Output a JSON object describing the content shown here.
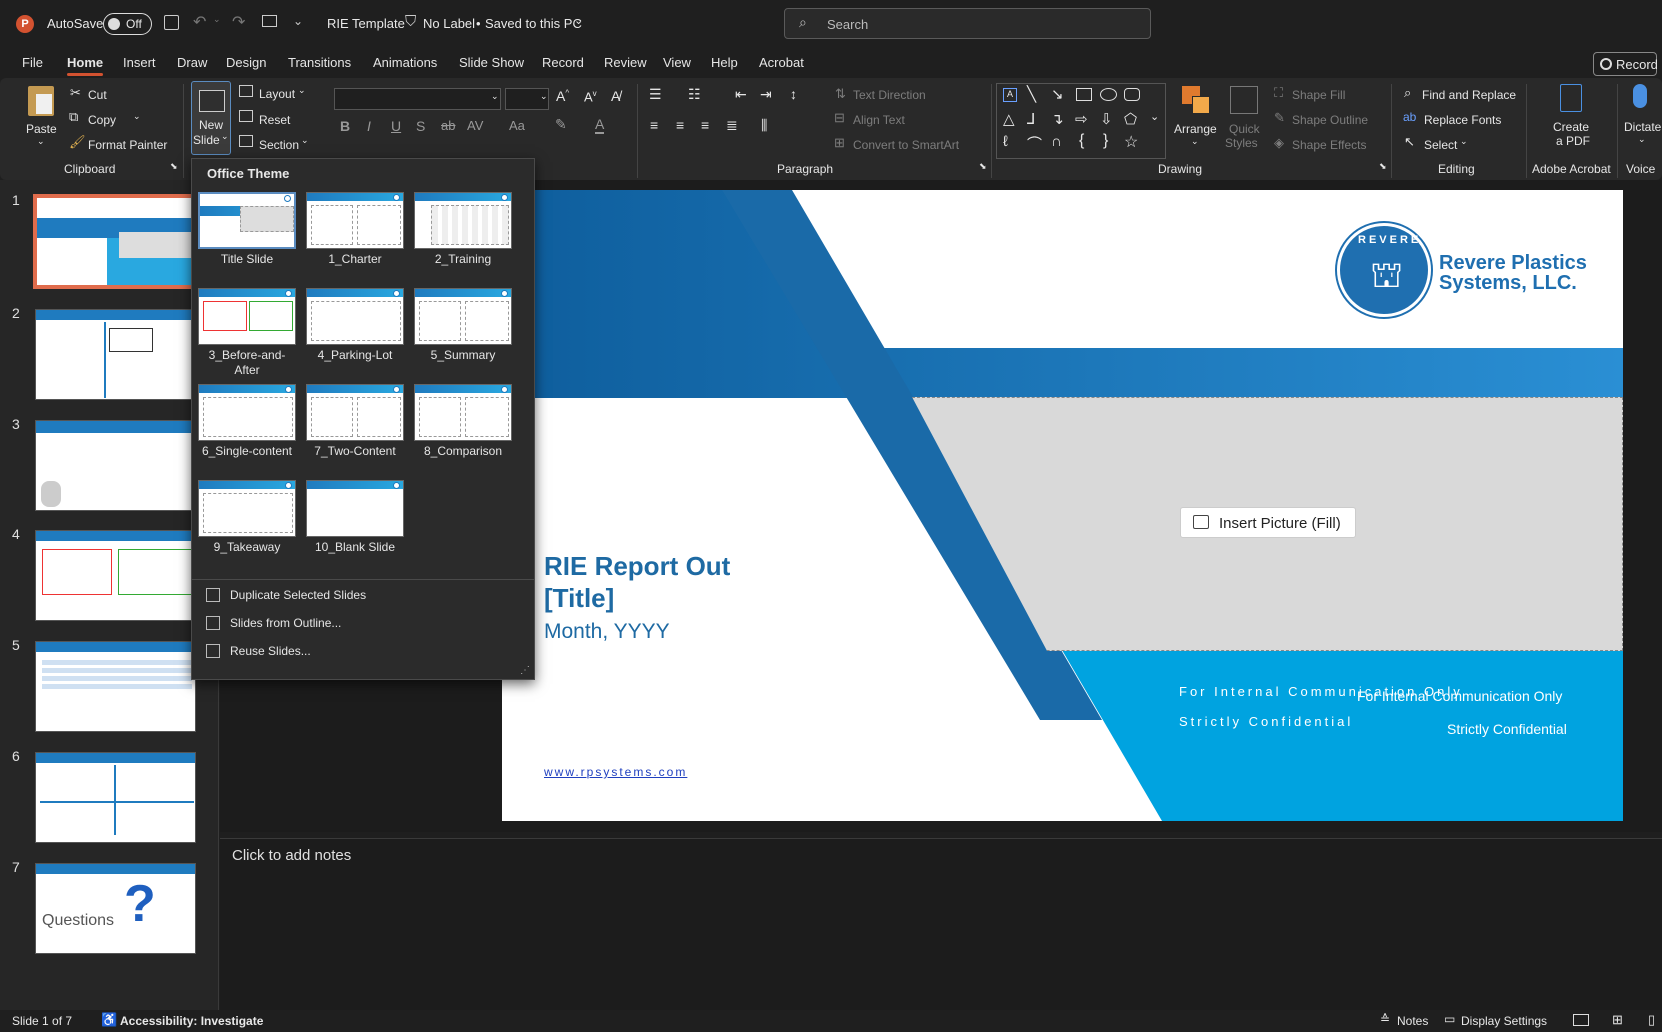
{
  "titlebar": {
    "autosave_label": "AutoSave",
    "autosave_state": "Off",
    "doc_title": "RIE Template",
    "label_status": "No Label",
    "save_status": "Saved to this PC",
    "search_placeholder": "Search"
  },
  "tabs": [
    "File",
    "Home",
    "Insert",
    "Draw",
    "Design",
    "Transitions",
    "Animations",
    "Slide Show",
    "Record",
    "Review",
    "View",
    "Help",
    "Acrobat"
  ],
  "record_button": "Record",
  "ribbon": {
    "clipboard": {
      "paste": "Paste",
      "cut": "Cut",
      "copy": "Copy",
      "format_painter": "Format Painter",
      "label": "Clipboard"
    },
    "slides": {
      "new_slide_1": "New",
      "new_slide_2": "Slide",
      "layout": "Layout",
      "reset": "Reset",
      "section": "Section"
    },
    "paragraph": {
      "text_direction": "Text Direction",
      "align_text": "Align Text",
      "convert_smartart": "Convert to SmartArt",
      "label": "Paragraph"
    },
    "drawing": {
      "arrange": "Arrange",
      "quick_styles_1": "Quick",
      "quick_styles_2": "Styles",
      "shape_fill": "Shape Fill",
      "shape_outline": "Shape Outline",
      "shape_effects": "Shape Effects",
      "label": "Drawing"
    },
    "editing": {
      "find_replace": "Find and Replace",
      "replace_fonts": "Replace Fonts",
      "select": "Select",
      "label": "Editing"
    },
    "acrobat": {
      "create_pdf_1": "Create",
      "create_pdf_2": "a PDF",
      "label": "Adobe Acrobat"
    },
    "voice": {
      "dictate": "Dictate",
      "label": "Voice"
    }
  },
  "dropdown": {
    "header": "Office Theme",
    "layouts": [
      "Title Slide",
      "1_Charter",
      "2_Training",
      "3_Before-and-After",
      "4_Parking-Lot",
      "5_Summary",
      "6_Single-content",
      "7_Two-Content",
      "8_Comparison",
      "9_Takeaway",
      "10_Blank Slide"
    ],
    "menu": [
      "Duplicate Selected Slides",
      "Slides from Outline...",
      "Reuse Slides..."
    ]
  },
  "thumbnails": [
    "1",
    "2",
    "3",
    "4",
    "5",
    "6",
    "7"
  ],
  "thumb7_text": "Questions",
  "slide": {
    "company_1": "Revere Plastics",
    "company_2": "Systems, LLC.",
    "logo_text": "REVERE",
    "title_1": "RIE Report Out",
    "title_2": "[Title]",
    "date": "Month, YYYY",
    "insert_picture": "Insert Picture (Fill)",
    "internal_a": "For Internal Communication Only",
    "confidential_a": "Strictly Confidential",
    "internal_b": "For Internal Communication Only",
    "confidential_b": "Strictly Confidential",
    "website": "www.rpsystems.com"
  },
  "notes_placeholder": "Click to add notes",
  "status": {
    "slide_count": "Slide 1 of 7",
    "accessibility": "Accessibility: Investigate",
    "notes": "Notes",
    "display_settings": "Display Settings"
  },
  "colors": {
    "accent": "#d35230",
    "brand_blue": "#1f7bbf",
    "sky_blue": "#00a3e0",
    "title_blue": "#1e6aa3"
  }
}
